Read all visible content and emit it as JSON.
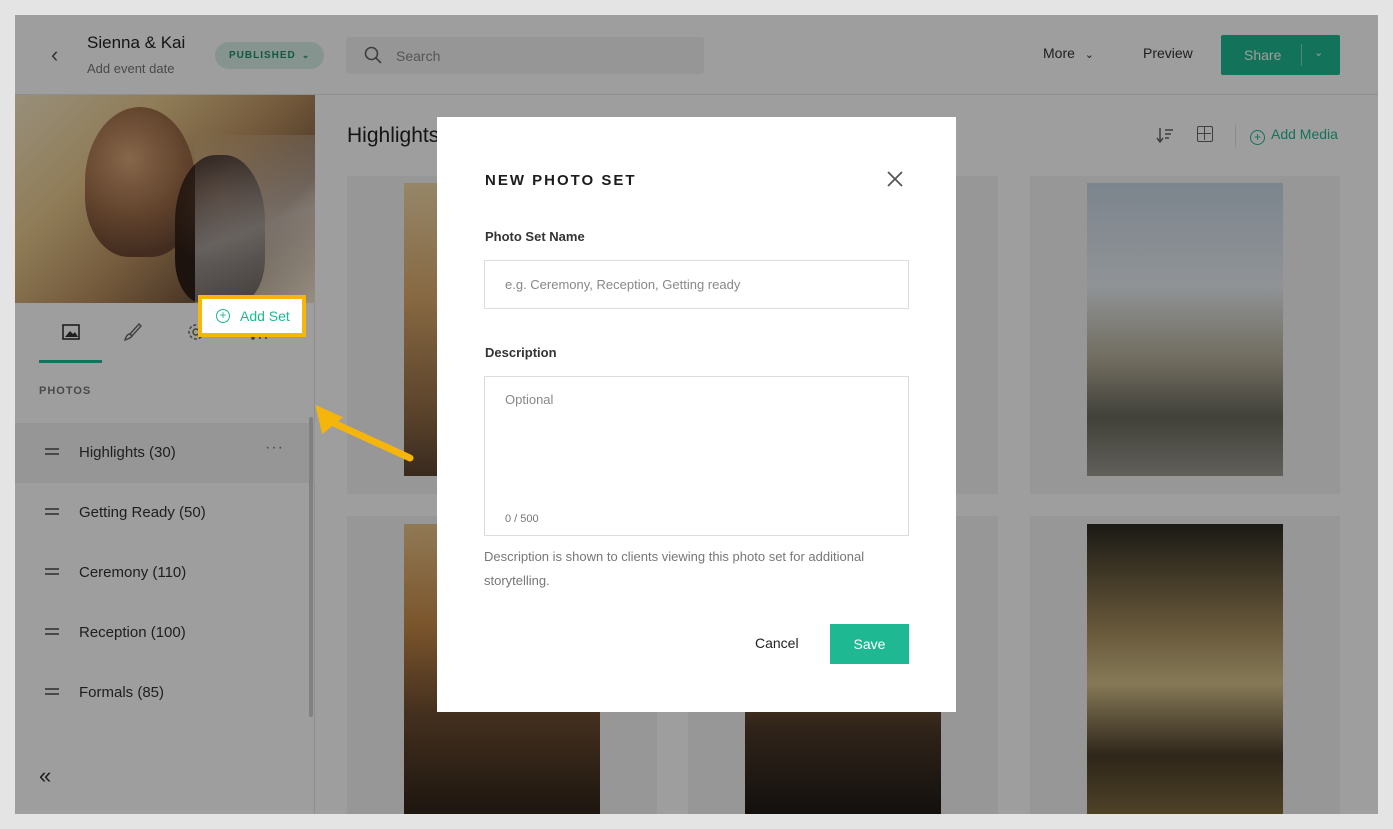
{
  "header": {
    "event_title": "Sienna & Kai",
    "event_date": "Add event date",
    "status_badge": "PUBLISHED",
    "search_placeholder": "Search",
    "more_label": "More",
    "preview_label": "Preview",
    "share_label": "Share"
  },
  "sidebar": {
    "section_label": "PHOTOS",
    "add_set_label": "Add Set",
    "tabs": [
      "photos-tab",
      "design-tab",
      "settings-tab",
      "activity-tab"
    ],
    "sets": [
      {
        "label": "Highlights (30)"
      },
      {
        "label": "Getting Ready (50)"
      },
      {
        "label": "Ceremony (110)"
      },
      {
        "label": "Reception (100)"
      },
      {
        "label": "Formals (85)"
      }
    ]
  },
  "main": {
    "title": "Highlights",
    "add_media_label": "Add Media"
  },
  "modal": {
    "title": "NEW PHOTO SET",
    "name_label": "Photo Set Name",
    "name_placeholder": "e.g. Ceremony, Reception, Getting ready",
    "desc_label": "Description",
    "desc_placeholder": "Optional",
    "counter": "0 / 500",
    "help_text": "Description is shown to clients viewing this photo set for additional storytelling.",
    "cancel_label": "Cancel",
    "save_label": "Save"
  },
  "colors": {
    "accent": "#1eb892",
    "callout": "#f5b50a",
    "badge_bg": "#d7efe6"
  }
}
